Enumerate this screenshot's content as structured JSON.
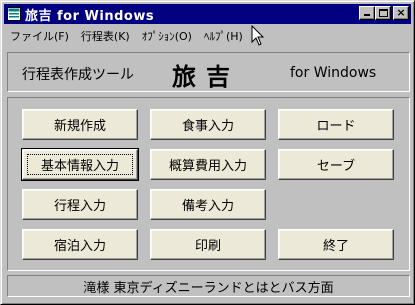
{
  "window": {
    "title": "旅吉 for Windows",
    "minimize_icon": "minimize-icon",
    "maximize_icon": "maximize-icon",
    "close_glyph": "×"
  },
  "menu": {
    "items": [
      {
        "label": "ファイル(F)"
      },
      {
        "label": "行程表(K)"
      },
      {
        "label": "ｵﾌﾟｼｮﾝ(O)"
      },
      {
        "label": "ﾍﾙﾌﾟ(H)"
      }
    ]
  },
  "header": {
    "subtitle": "行程表作成ツール",
    "title": "旅吉",
    "suffix": "for Windows"
  },
  "buttons": {
    "new": "新規作成",
    "meal": "食事入力",
    "load": "ロード",
    "basic_info": "基本情報入力",
    "estimate": "概算費用入力",
    "save": "セーブ",
    "itinerary": "行程入力",
    "remarks": "備考入力",
    "lodging": "宿泊入力",
    "print": "印刷",
    "exit": "終了"
  },
  "status": {
    "text": "滝様  東京ディズニーランドとはとバス方面"
  },
  "colors": {
    "titlebar": "#000080",
    "window_face": "#c0c0c0",
    "button_face": "#ece9d8"
  }
}
